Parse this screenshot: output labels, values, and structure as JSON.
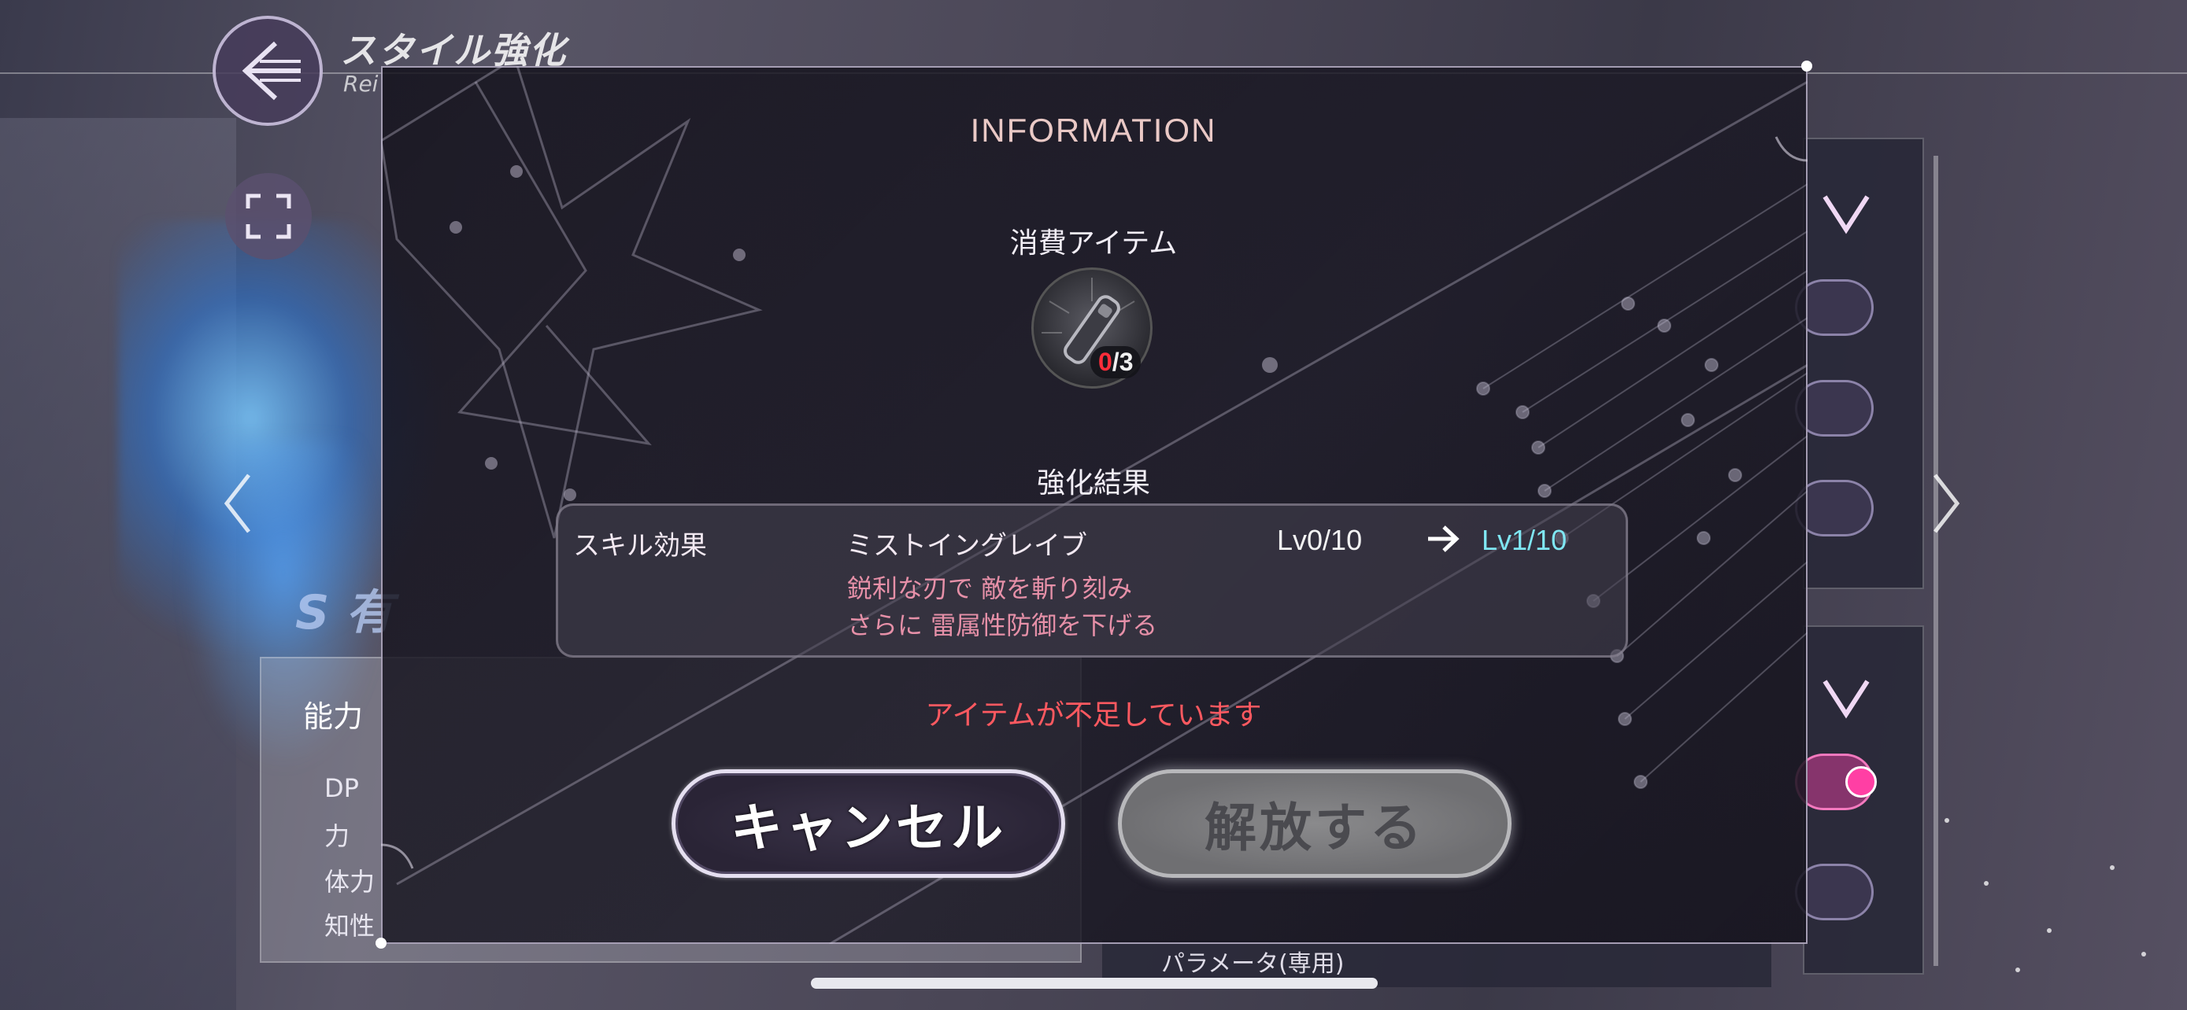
{
  "background": {
    "screen_title": "スタイル強化",
    "screen_subtitle": "Rei",
    "style_name": "S 有",
    "ability": {
      "title": "能力",
      "stats": [
        "DP",
        "力",
        "体力",
        "知性"
      ]
    },
    "param_label": "パラメータ(専用)"
  },
  "dialog": {
    "title": "INFORMATION",
    "consume_label": "消費アイテム",
    "item": {
      "icon": "sword-hilt-icon",
      "have": "0",
      "need": "/3"
    },
    "result_label": "強化結果",
    "result": {
      "category": "スキル効果",
      "skill_name": "ミストイングレイブ",
      "level_from": "Lv0/10",
      "level_to": "Lv1/10",
      "description": [
        "鋭利な刃で 敵を斬り刻み",
        "さらに 雷属性防御を下げる"
      ]
    },
    "warning": "アイテムが不足しています",
    "cancel_label": "キャンセル",
    "release_label": "解放する"
  },
  "colors": {
    "title": "#eac9c6",
    "level_to": "#7fe6f2",
    "description": "#e690a8",
    "warning": "#ff5960",
    "count_have": "#ff2d3a"
  }
}
